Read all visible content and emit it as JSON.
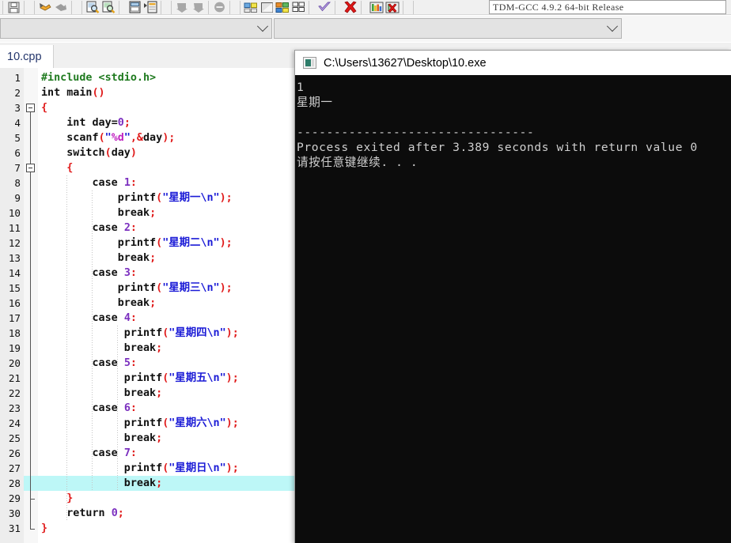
{
  "toolbar": {
    "icons": [
      {
        "name": "save-icon",
        "kind": "save"
      },
      {
        "name": "undo-icon",
        "kind": "undo"
      },
      {
        "name": "redo-icon",
        "kind": "redo"
      },
      {
        "name": "find-icon",
        "kind": "find"
      },
      {
        "name": "replace-icon",
        "kind": "replace"
      },
      {
        "name": "goto-line-icon",
        "kind": "goto"
      },
      {
        "name": "toggle-bookmark-icon",
        "kind": "bookmark"
      },
      {
        "name": "indent-icon",
        "kind": "indent"
      },
      {
        "name": "unindent-icon",
        "kind": "unindent"
      },
      {
        "name": "toggle-comment-icon",
        "kind": "comment"
      },
      {
        "name": "compile-icon",
        "kind": "compile"
      },
      {
        "name": "run-icon",
        "kind": "run"
      },
      {
        "name": "compile-and-run-icon",
        "kind": "compilerun"
      },
      {
        "name": "rebuild-all-icon",
        "kind": "rebuild"
      },
      {
        "name": "syntax-check-icon",
        "kind": "check"
      },
      {
        "name": "stop-execution-icon",
        "kind": "stop"
      },
      {
        "name": "profile-icon",
        "kind": "profile"
      },
      {
        "name": "delete-profile-icon",
        "kind": "delprofile"
      }
    ],
    "compiler_set": "TDM-GCC 4.9.2 64-bit Release"
  },
  "dropdowns": {
    "class_browser": {
      "value": "",
      "placeholder": ""
    },
    "member_list": {
      "value": "",
      "placeholder": ""
    }
  },
  "tabs": [
    {
      "label": "10.cpp",
      "active": true
    }
  ],
  "editor": {
    "highlighted_line": 28,
    "lines": [
      {
        "n": 1,
        "tokens": [
          {
            "t": "#include <stdio.h>",
            "c": "t-pre"
          }
        ]
      },
      {
        "n": 2,
        "tokens": [
          {
            "t": "int",
            "c": "t-kw"
          },
          {
            "t": " main",
            "c": "t-fn"
          },
          {
            "t": "()",
            "c": "t-pun"
          }
        ]
      },
      {
        "n": 3,
        "tokens": [
          {
            "t": "{",
            "c": "t-brace"
          }
        ]
      },
      {
        "n": 4,
        "tokens": [
          {
            "t": "    int",
            "c": "t-kw"
          },
          {
            "t": " day",
            "c": "t-id"
          },
          {
            "t": "=",
            "c": "t-id"
          },
          {
            "t": "0",
            "c": "t-num"
          },
          {
            "t": ";",
            "c": "t-pun"
          }
        ]
      },
      {
        "n": 5,
        "tokens": [
          {
            "t": "    scanf",
            "c": "t-fn"
          },
          {
            "t": "(",
            "c": "t-pun"
          },
          {
            "t": "\"",
            "c": "t-str"
          },
          {
            "t": "%d",
            "c": "t-fmt"
          },
          {
            "t": "\"",
            "c": "t-str"
          },
          {
            "t": ",&",
            "c": "t-pun"
          },
          {
            "t": "day",
            "c": "t-id"
          },
          {
            "t": ");",
            "c": "t-pun"
          }
        ]
      },
      {
        "n": 6,
        "tokens": [
          {
            "t": "    switch",
            "c": "t-kw"
          },
          {
            "t": "(",
            "c": "t-pun"
          },
          {
            "t": "day",
            "c": "t-id"
          },
          {
            "t": ")",
            "c": "t-pun"
          }
        ]
      },
      {
        "n": 7,
        "tokens": [
          {
            "t": "    {",
            "c": "t-brace"
          }
        ]
      },
      {
        "n": 8,
        "tokens": [
          {
            "t": "        case",
            "c": "t-kw"
          },
          {
            "t": " ",
            "c": "t-id"
          },
          {
            "t": "1",
            "c": "t-num"
          },
          {
            "t": ":",
            "c": "t-pun"
          }
        ]
      },
      {
        "n": 9,
        "tokens": [
          {
            "t": "            printf",
            "c": "t-fn"
          },
          {
            "t": "(",
            "c": "t-pun"
          },
          {
            "t": "\"星期一\\n\"",
            "c": "t-str"
          },
          {
            "t": ");",
            "c": "t-pun"
          }
        ]
      },
      {
        "n": 10,
        "tokens": [
          {
            "t": "            break",
            "c": "t-kw"
          },
          {
            "t": ";",
            "c": "t-pun"
          }
        ]
      },
      {
        "n": 11,
        "tokens": [
          {
            "t": "        case",
            "c": "t-kw"
          },
          {
            "t": " ",
            "c": "t-id"
          },
          {
            "t": "2",
            "c": "t-num"
          },
          {
            "t": ":",
            "c": "t-pun"
          }
        ]
      },
      {
        "n": 12,
        "tokens": [
          {
            "t": "            printf",
            "c": "t-fn"
          },
          {
            "t": "(",
            "c": "t-pun"
          },
          {
            "t": "\"星期二\\n\"",
            "c": "t-str"
          },
          {
            "t": ");",
            "c": "t-pun"
          }
        ]
      },
      {
        "n": 13,
        "tokens": [
          {
            "t": "            break",
            "c": "t-kw"
          },
          {
            "t": ";",
            "c": "t-pun"
          }
        ]
      },
      {
        "n": 14,
        "tokens": [
          {
            "t": "        case",
            "c": "t-kw"
          },
          {
            "t": " ",
            "c": "t-id"
          },
          {
            "t": "3",
            "c": "t-num"
          },
          {
            "t": ":",
            "c": "t-pun"
          }
        ]
      },
      {
        "n": 15,
        "tokens": [
          {
            "t": "            printf",
            "c": "t-fn"
          },
          {
            "t": "(",
            "c": "t-pun"
          },
          {
            "t": "\"星期三\\n\"",
            "c": "t-str"
          },
          {
            "t": ");",
            "c": "t-pun"
          }
        ]
      },
      {
        "n": 16,
        "tokens": [
          {
            "t": "            break",
            "c": "t-kw"
          },
          {
            "t": ";",
            "c": "t-pun"
          }
        ]
      },
      {
        "n": 17,
        "tokens": [
          {
            "t": "        case",
            "c": "t-kw"
          },
          {
            "t": " ",
            "c": "t-id"
          },
          {
            "t": "4",
            "c": "t-num"
          },
          {
            "t": ":",
            "c": "t-pun"
          }
        ]
      },
      {
        "n": 18,
        "tokens": [
          {
            "t": "             printf",
            "c": "t-fn"
          },
          {
            "t": "(",
            "c": "t-pun"
          },
          {
            "t": "\"星期四\\n\"",
            "c": "t-str"
          },
          {
            "t": ");",
            "c": "t-pun"
          }
        ]
      },
      {
        "n": 19,
        "tokens": [
          {
            "t": "             break",
            "c": "t-kw"
          },
          {
            "t": ";",
            "c": "t-pun"
          }
        ]
      },
      {
        "n": 20,
        "tokens": [
          {
            "t": "        case",
            "c": "t-kw"
          },
          {
            "t": " ",
            "c": "t-id"
          },
          {
            "t": "5",
            "c": "t-num"
          },
          {
            "t": ":",
            "c": "t-pun"
          }
        ]
      },
      {
        "n": 21,
        "tokens": [
          {
            "t": "             printf",
            "c": "t-fn"
          },
          {
            "t": "(",
            "c": "t-pun"
          },
          {
            "t": "\"星期五\\n\"",
            "c": "t-str"
          },
          {
            "t": ");",
            "c": "t-pun"
          }
        ]
      },
      {
        "n": 22,
        "tokens": [
          {
            "t": "             break",
            "c": "t-kw"
          },
          {
            "t": ";",
            "c": "t-pun"
          }
        ]
      },
      {
        "n": 23,
        "tokens": [
          {
            "t": "        case",
            "c": "t-kw"
          },
          {
            "t": " ",
            "c": "t-id"
          },
          {
            "t": "6",
            "c": "t-num"
          },
          {
            "t": ":",
            "c": "t-pun"
          }
        ]
      },
      {
        "n": 24,
        "tokens": [
          {
            "t": "             printf",
            "c": "t-fn"
          },
          {
            "t": "(",
            "c": "t-pun"
          },
          {
            "t": "\"星期六\\n\"",
            "c": "t-str"
          },
          {
            "t": ");",
            "c": "t-pun"
          }
        ]
      },
      {
        "n": 25,
        "tokens": [
          {
            "t": "             break",
            "c": "t-kw"
          },
          {
            "t": ";",
            "c": "t-pun"
          }
        ]
      },
      {
        "n": 26,
        "tokens": [
          {
            "t": "        case",
            "c": "t-kw"
          },
          {
            "t": " ",
            "c": "t-id"
          },
          {
            "t": "7",
            "c": "t-num"
          },
          {
            "t": ":",
            "c": "t-pun"
          }
        ]
      },
      {
        "n": 27,
        "tokens": [
          {
            "t": "             printf",
            "c": "t-fn"
          },
          {
            "t": "(",
            "c": "t-pun"
          },
          {
            "t": "\"星期日\\n\"",
            "c": "t-str"
          },
          {
            "t": ");",
            "c": "t-pun"
          }
        ]
      },
      {
        "n": 28,
        "tokens": [
          {
            "t": "             break",
            "c": "t-kw"
          },
          {
            "t": ";",
            "c": "t-pun"
          }
        ]
      },
      {
        "n": 29,
        "tokens": [
          {
            "t": "    }",
            "c": "t-brace"
          }
        ]
      },
      {
        "n": 30,
        "tokens": [
          {
            "t": "    return",
            "c": "t-kw"
          },
          {
            "t": " ",
            "c": "t-id"
          },
          {
            "t": "0",
            "c": "t-num"
          },
          {
            "t": ";",
            "c": "t-pun"
          }
        ]
      },
      {
        "n": 31,
        "tokens": [
          {
            "t": "}",
            "c": "t-brace"
          }
        ]
      }
    ]
  },
  "console": {
    "title": "C:\\Users\\13627\\Desktop\\10.exe",
    "icon": "console-window-icon",
    "output_lines": [
      "1",
      "星期一",
      "",
      "--------------------------------",
      "Process exited after 3.389 seconds with return value 0",
      "请按任意键继续. . ."
    ]
  },
  "colors": {
    "console_bg": "#0c0c0c",
    "console_fg": "#cfcfcf",
    "highlight_line": "#bdf7f7",
    "string": "#1a1ad6",
    "punctuation": "#e01b1b",
    "preprocessor": "#1f7a1f",
    "number": "#7b2fbf",
    "tab_text": "#23356b"
  }
}
